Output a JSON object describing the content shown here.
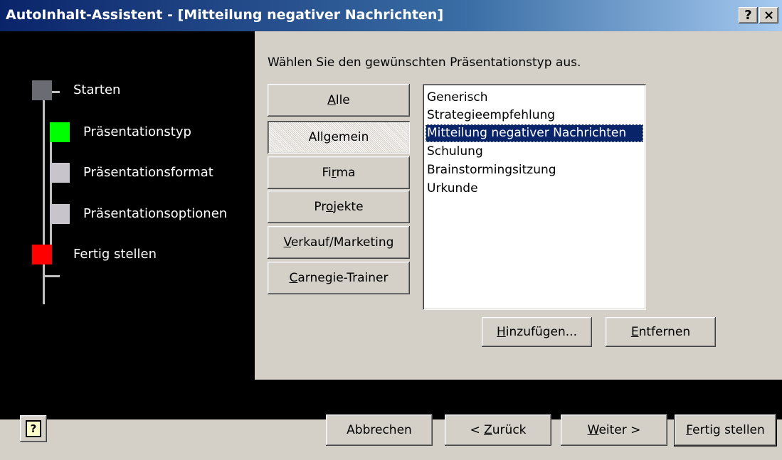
{
  "window": {
    "title": "AutoInhalt-Assistent - [Mitteilung negativer Nachrichten]",
    "help_glyph": "?",
    "close_glyph": "×"
  },
  "steps": [
    {
      "label": "Starten",
      "color": "#6b6b73"
    },
    {
      "label": "Präsentationstyp",
      "color": "#00ff00"
    },
    {
      "label": "Präsentationsformat",
      "color": "#c8c4cc"
    },
    {
      "label": "Präsentationsoptionen",
      "color": "#c8c4cc"
    },
    {
      "label": "Fertig stellen",
      "color": "#ff0000"
    }
  ],
  "content": {
    "prompt": "Wählen Sie den gewünschten Präsentationstyp aus."
  },
  "categories": [
    {
      "pre": "",
      "key": "A",
      "post": "lle",
      "state": "normal"
    },
    {
      "pre": "All",
      "key": "g",
      "post": "emein",
      "state": "pressed"
    },
    {
      "pre": "Fi",
      "key": "r",
      "post": "ma",
      "state": "normal"
    },
    {
      "pre": "Pr",
      "key": "o",
      "post": "jekte",
      "state": "normal"
    },
    {
      "pre": "",
      "key": "V",
      "post": "erkauf/Marketing",
      "state": "normal"
    },
    {
      "pre": "",
      "key": "C",
      "post": "arnegie-Trainer",
      "state": "normal"
    }
  ],
  "presentation_types": [
    {
      "label": "Generisch",
      "selected": false
    },
    {
      "label": "Strategieempfehlung",
      "selected": false
    },
    {
      "label": "Mitteilung negativer Nachrichten",
      "selected": true
    },
    {
      "label": "Schulung",
      "selected": false
    },
    {
      "label": "Brainstormingsitzung",
      "selected": false
    },
    {
      "label": "Urkunde",
      "selected": false
    }
  ],
  "list_actions": {
    "add": {
      "pre": "",
      "key": "H",
      "post": "inzufügen..."
    },
    "remove": {
      "pre": "",
      "key": "E",
      "post": "ntfernen"
    }
  },
  "footer": {
    "help_glyph": "?",
    "cancel": {
      "pre": "Abbrechen",
      "key": "",
      "post": ""
    },
    "back": {
      "pre": "< ",
      "key": "Z",
      "post": "urück"
    },
    "next": {
      "pre": "",
      "key": "W",
      "post": "eiter >"
    },
    "finish": {
      "pre": "",
      "key": "F",
      "post": "ertig stellen"
    }
  },
  "icons": {
    "help_button_icon": "help-icon"
  }
}
